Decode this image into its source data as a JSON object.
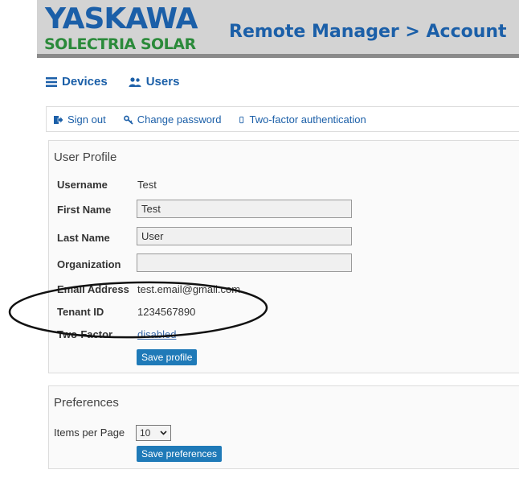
{
  "header": {
    "logo_line1": "YASKAWA",
    "logo_line2": "SOLECTRIA SOLAR",
    "title": "Remote Manager > Account"
  },
  "nav": {
    "items": [
      {
        "label": "Devices",
        "icon": "list-icon"
      },
      {
        "label": "Users",
        "icon": "users-icon"
      }
    ]
  },
  "actions": [
    {
      "label": "Sign out",
      "icon": "sign-out-icon"
    },
    {
      "label": "Change password",
      "icon": "key-icon"
    },
    {
      "label": "Two-factor authentication",
      "icon": "mobile-icon"
    }
  ],
  "profile": {
    "title": "User Profile",
    "username_label": "Username",
    "username": "Test",
    "first_name_label": "First Name",
    "first_name": "Test",
    "last_name_label": "Last Name",
    "last_name": "User",
    "organization_label": "Organization",
    "organization": "",
    "email_label": "Email Address",
    "email": "test.email@gmail.com",
    "tenant_label": "Tenant ID",
    "tenant_id": "1234567890",
    "two_factor_label": "Two-Factor",
    "two_factor_value": "disabled",
    "save_label": "Save profile"
  },
  "preferences": {
    "title": "Preferences",
    "items_per_page_label": "Items per Page",
    "items_per_page_value": "10",
    "save_label": "Save preferences"
  },
  "colors": {
    "brand_blue": "#1b5fa8",
    "brand_green": "#2b8a3a",
    "button_blue": "#1f7ab8"
  }
}
